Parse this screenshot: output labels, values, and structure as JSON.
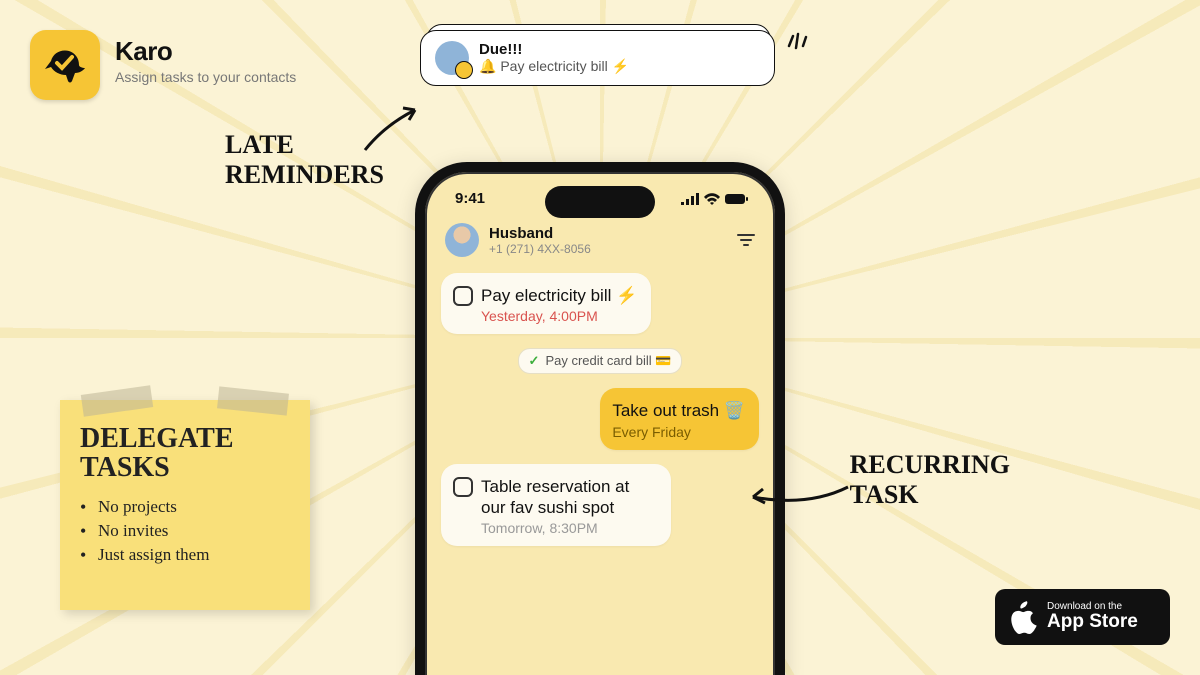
{
  "app": {
    "name": "Karo",
    "tagline": "Assign tasks to your contacts"
  },
  "callouts": {
    "late_1": "LATE",
    "late_2": "REMINDERS",
    "recurring_1": "RECURRING",
    "recurring_2": "TASK"
  },
  "notification": {
    "title": "Due!!!",
    "body": "🔔 Pay electricity bill ⚡"
  },
  "phone": {
    "time": "9:41",
    "contact_name": "Husband",
    "contact_number": "+1 (271) 4XX-8056"
  },
  "tasks": {
    "t1_title": "Pay electricity bill ⚡",
    "t1_meta": "Yesterday, 4:00PM",
    "completed_label": "Pay credit card bill 💳",
    "t2_title": "Take out trash 🗑️",
    "t2_meta": "Every Friday",
    "t3_title": "Table reservation at our fav sushi spot",
    "t3_meta": "Tomorrow, 8:30PM"
  },
  "sticky": {
    "heading_1": "DELEGATE",
    "heading_2": "TASKS",
    "bullet_1": "No projects",
    "bullet_2": "No invites",
    "bullet_3": "Just assign them"
  },
  "appstore": {
    "line1": "Download on the",
    "line2": "App Store"
  }
}
